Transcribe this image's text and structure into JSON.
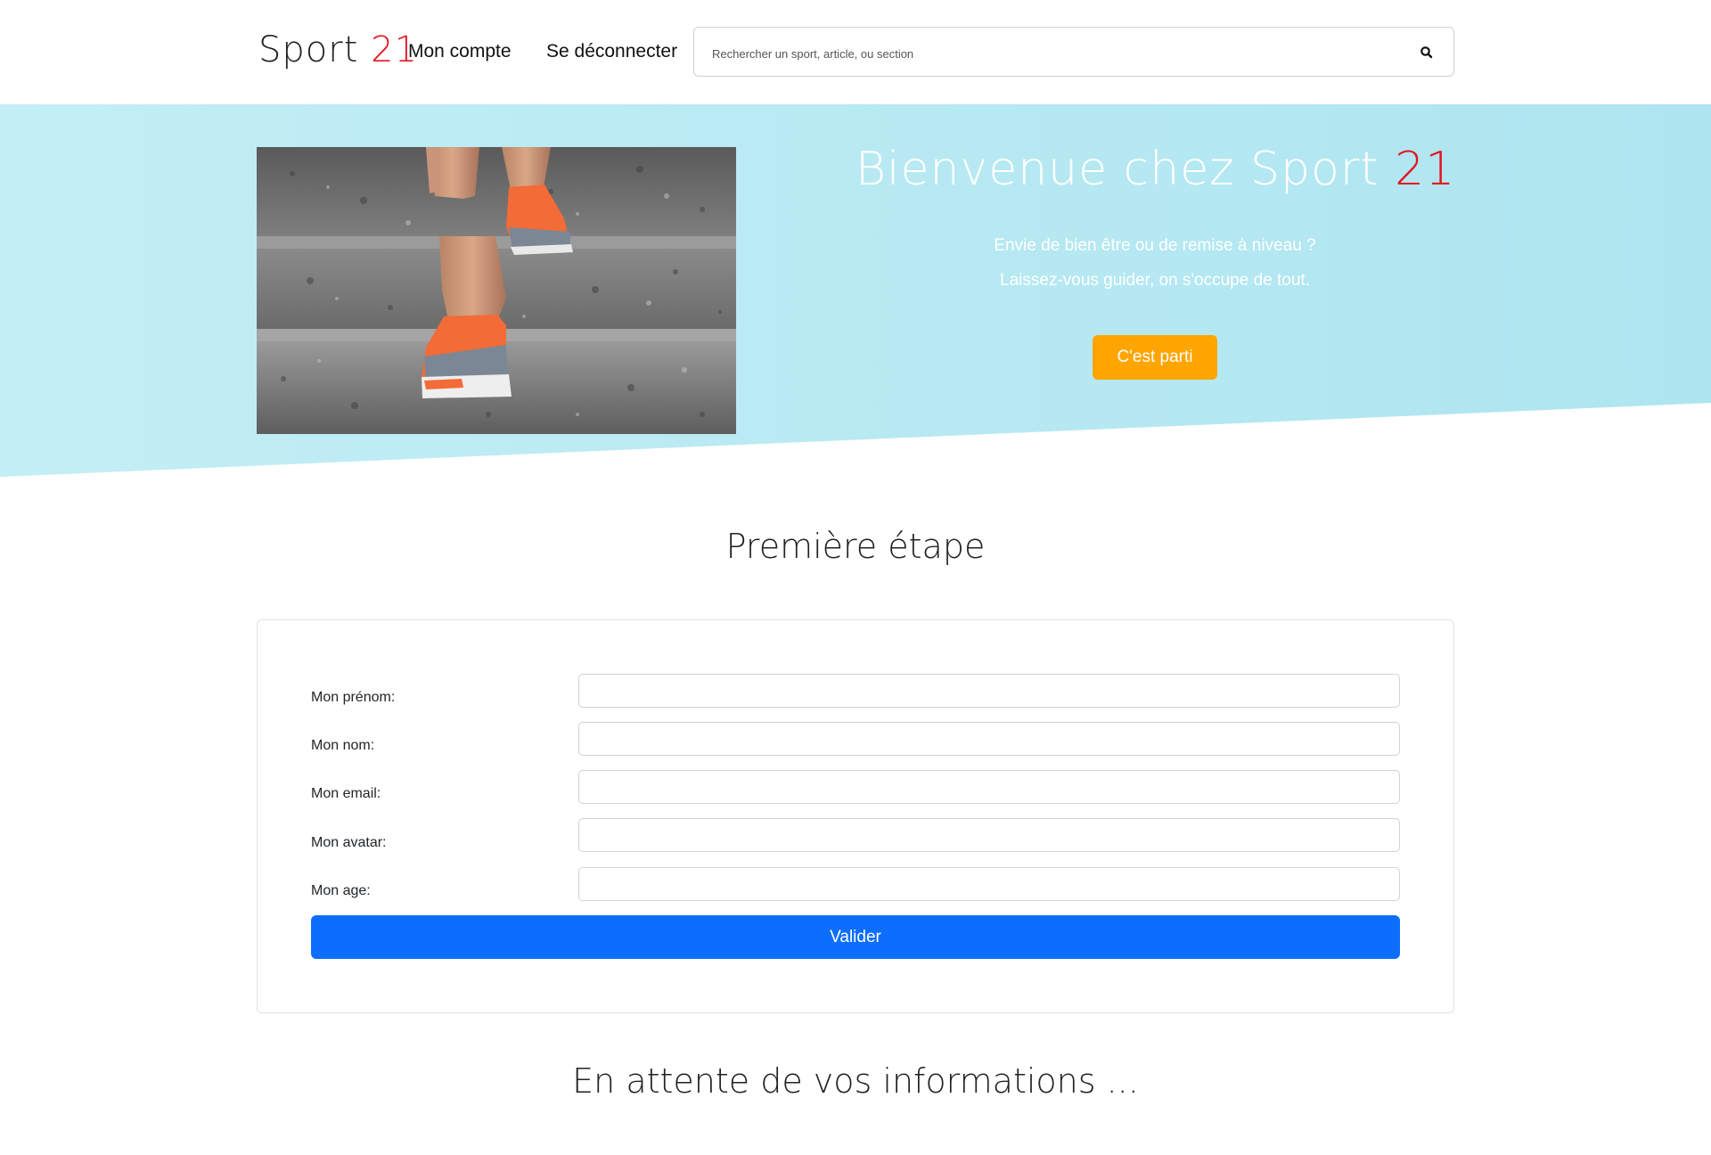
{
  "header": {
    "brand_name": "Sport",
    "brand_number": "21",
    "nav": {
      "account": "Mon compte",
      "logout": "Se déconnecter"
    },
    "search": {
      "placeholder": "Rechercher un sport, article, ou section"
    }
  },
  "hero": {
    "title_prefix": "Bienvenue chez Sport",
    "title_accent": "21",
    "line1": "Envie de bien être ou de remise à niveau ?",
    "line2": "Laissez-vous guider, on s'occupe de tout.",
    "cta_label": "C'est parti",
    "cta_color": "#ffa500",
    "background_color": "#b5e9f3",
    "accent_color": "#e5141e"
  },
  "form": {
    "title": "Première étape",
    "fields": [
      {
        "label": "Mon prénom:",
        "value": ""
      },
      {
        "label": "Mon nom:",
        "value": ""
      },
      {
        "label": "Mon email:",
        "value": ""
      },
      {
        "label": "Mon avatar:",
        "value": ""
      },
      {
        "label": "Mon age:",
        "value": ""
      }
    ],
    "submit_label": "Valider",
    "submit_color": "#0d6efd"
  },
  "status": {
    "waiting_text": "En attente de vos informations ..."
  }
}
